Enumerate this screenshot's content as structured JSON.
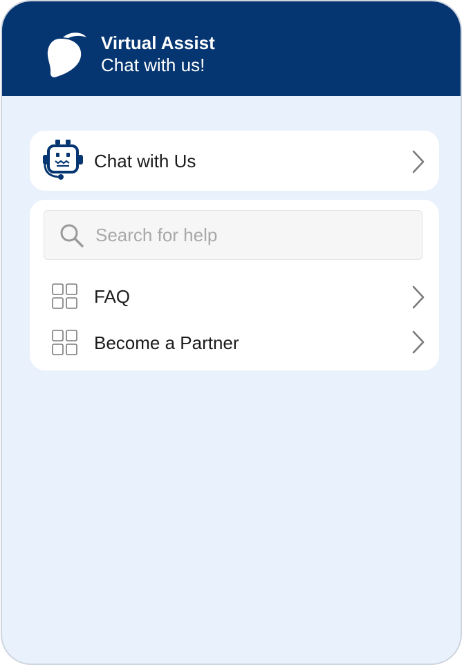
{
  "colors": {
    "header_bg": "#063671",
    "body_bg": "#e9f1fc",
    "card_bg": "#ffffff",
    "icon_gray": "#7a7a7a"
  },
  "header": {
    "logo_icon": "mango-logo-icon",
    "title": "Virtual Assist",
    "subtitle": "Chat with us!"
  },
  "chat_card": {
    "icon": "chatbot-headset-icon",
    "label": "Chat with Us",
    "chevron_icon": "chevron-right-icon"
  },
  "help_card": {
    "search": {
      "icon": "search-icon",
      "placeholder": "Search for help",
      "value": ""
    },
    "items": [
      {
        "icon": "grid-icon",
        "label": "FAQ",
        "chevron_icon": "chevron-right-icon"
      },
      {
        "icon": "grid-icon",
        "label": "Become a Partner",
        "chevron_icon": "chevron-right-icon"
      }
    ]
  }
}
